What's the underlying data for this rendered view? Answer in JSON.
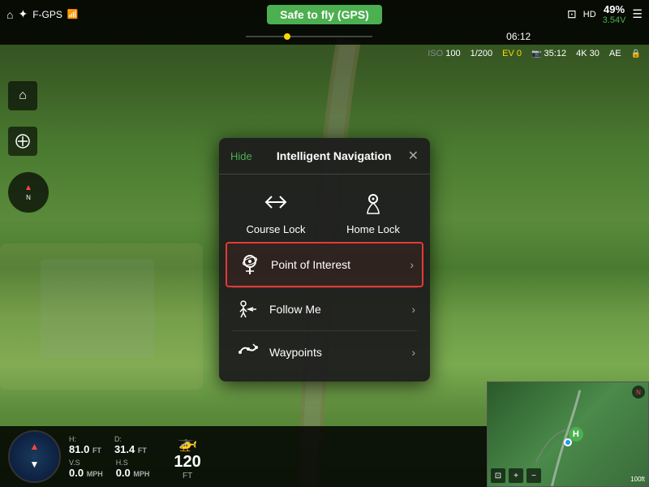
{
  "topbar": {
    "home_icon": "⌂",
    "drone_icon": "✦",
    "gps_label": "F-GPS",
    "signal_icon": "📶",
    "safe_label": "Safe to fly (GPS)",
    "timer": "06:12",
    "stream_icon": "⊡",
    "hd_label": "HD",
    "battery_pct": "49%",
    "battery_v": "3.54V",
    "menu_icon": "☰"
  },
  "camera_row": {
    "iso_label": "ISO",
    "iso_val": "100",
    "shutter": "1/200",
    "ev_label": "EV",
    "ev_val": "0",
    "storage_label": "35:12",
    "res": "4K",
    "fps": "30",
    "ae": "AE",
    "lock": "🔒"
  },
  "modal": {
    "hide_btn": "Hide",
    "title": "Intelligent Navigation",
    "close": "✕",
    "top_items": [
      {
        "icon": "⇄",
        "label": "Course Lock"
      },
      {
        "icon": "◎",
        "label": "Home Lock"
      }
    ],
    "list_items": [
      {
        "icon": "⊙",
        "label": "Point of Interest",
        "chevron": "›",
        "highlighted": true
      },
      {
        "icon": "🚶",
        "label": "Follow Me",
        "chevron": "›",
        "highlighted": false
      },
      {
        "icon": "⟳",
        "label": "Waypoints",
        "chevron": "›",
        "highlighted": false
      }
    ]
  },
  "left_controls": {
    "btn1": "⌂",
    "btn2": "↗",
    "btn3": "N"
  },
  "bottom_hud": {
    "h_label": "H:",
    "h_val": "81.0",
    "h_unit": "FT",
    "d_label": "D:",
    "d_val": "31.4",
    "d_unit": "FT",
    "vs_label": "V.S",
    "vs_val": "0.0",
    "vs_unit": "MPH",
    "hs_label": "H.S",
    "hs_val": "0.0",
    "hs_unit": "MPH",
    "alt_val": "120",
    "alt_unit": "FT"
  },
  "minimap": {
    "h_marker": "H",
    "scale": "100ft",
    "compass": "N",
    "plus": "+",
    "minus": "−",
    "expand": "⊡"
  }
}
